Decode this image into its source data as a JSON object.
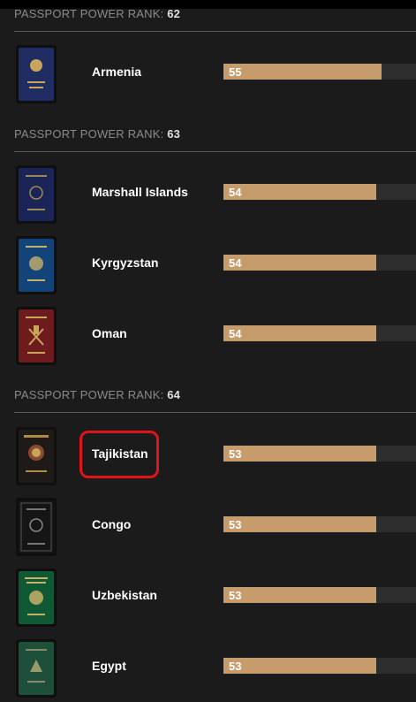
{
  "header_label": "PASSPORT POWER RANK:",
  "groups": [
    {
      "rank": "62"
    },
    {
      "rank": "63"
    },
    {
      "rank": "64"
    }
  ],
  "countries": [
    {
      "name": "Armenia",
      "score": "55",
      "cover_color": "#1f2d63"
    },
    {
      "name": "Marshall Islands",
      "score": "54",
      "cover_color": "#1b2456"
    },
    {
      "name": "Kyrgyzstan",
      "score": "54",
      "cover_color": "#12447a"
    },
    {
      "name": "Oman",
      "score": "54",
      "cover_color": "#6e1b1e"
    },
    {
      "name": "Tajikistan",
      "score": "53",
      "cover_color": "#1e1a18"
    },
    {
      "name": "Congo",
      "score": "53",
      "cover_color": "#151515"
    },
    {
      "name": "Uzbekistan",
      "score": "53",
      "cover_color": "#0f5a34"
    },
    {
      "name": "Egypt",
      "score": "53",
      "cover_color": "#1d4f3a"
    }
  ],
  "bar_color": "#c69c6d",
  "highlight_color": "#e0151b"
}
